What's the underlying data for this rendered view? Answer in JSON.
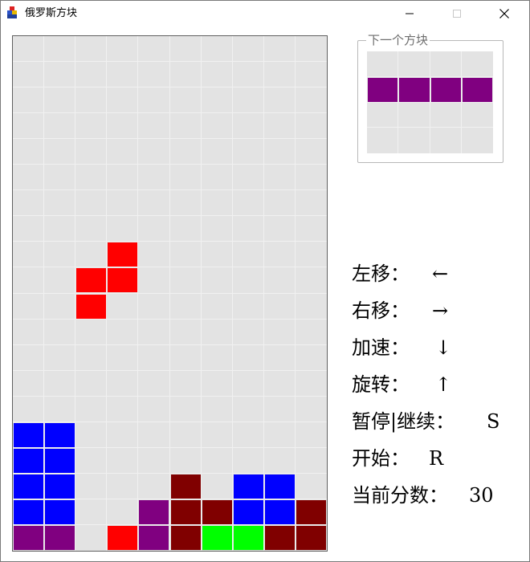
{
  "window": {
    "title": "俄罗斯方块"
  },
  "board": {
    "cols": 10,
    "rows": 20,
    "empty_color": "#e3e3e3",
    "cells": [
      {
        "r": 8,
        "c": 3,
        "color": "#ff0000"
      },
      {
        "r": 9,
        "c": 2,
        "color": "#ff0000"
      },
      {
        "r": 9,
        "c": 3,
        "color": "#ff0000"
      },
      {
        "r": 10,
        "c": 2,
        "color": "#ff0000"
      },
      {
        "r": 15,
        "c": 0,
        "color": "#0000ff"
      },
      {
        "r": 15,
        "c": 1,
        "color": "#0000ff"
      },
      {
        "r": 16,
        "c": 0,
        "color": "#0000ff"
      },
      {
        "r": 16,
        "c": 1,
        "color": "#0000ff"
      },
      {
        "r": 17,
        "c": 0,
        "color": "#0000ff"
      },
      {
        "r": 17,
        "c": 1,
        "color": "#0000ff"
      },
      {
        "r": 17,
        "c": 5,
        "color": "#800000"
      },
      {
        "r": 17,
        "c": 7,
        "color": "#0000ff"
      },
      {
        "r": 17,
        "c": 8,
        "color": "#0000ff"
      },
      {
        "r": 18,
        "c": 0,
        "color": "#0000ff"
      },
      {
        "r": 18,
        "c": 1,
        "color": "#0000ff"
      },
      {
        "r": 18,
        "c": 4,
        "color": "#800080"
      },
      {
        "r": 18,
        "c": 5,
        "color": "#800000"
      },
      {
        "r": 18,
        "c": 6,
        "color": "#800000"
      },
      {
        "r": 18,
        "c": 7,
        "color": "#0000ff"
      },
      {
        "r": 18,
        "c": 8,
        "color": "#0000ff"
      },
      {
        "r": 18,
        "c": 9,
        "color": "#800000"
      },
      {
        "r": 19,
        "c": 0,
        "color": "#800080"
      },
      {
        "r": 19,
        "c": 1,
        "color": "#800080"
      },
      {
        "r": 19,
        "c": 3,
        "color": "#ff0000"
      },
      {
        "r": 19,
        "c": 4,
        "color": "#800080"
      },
      {
        "r": 19,
        "c": 5,
        "color": "#800000"
      },
      {
        "r": 19,
        "c": 6,
        "color": "#00ff00"
      },
      {
        "r": 19,
        "c": 7,
        "color": "#00ff00"
      },
      {
        "r": 19,
        "c": 8,
        "color": "#800000"
      },
      {
        "r": 19,
        "c": 9,
        "color": "#800000"
      }
    ]
  },
  "next_piece": {
    "legend": "下一个方块",
    "cols": 4,
    "rows": 4,
    "cells": [
      {
        "r": 1,
        "c": 0,
        "color": "#800080"
      },
      {
        "r": 1,
        "c": 1,
        "color": "#800080"
      },
      {
        "r": 1,
        "c": 2,
        "color": "#800080"
      },
      {
        "r": 1,
        "c": 3,
        "color": "#800080"
      }
    ]
  },
  "controls": {
    "move_left": {
      "label": "左移：",
      "key": "←"
    },
    "move_right": {
      "label": "右移：",
      "key": "→"
    },
    "speed_up": {
      "label": "加速：",
      "key": "↓"
    },
    "rotate": {
      "label": "旋转：",
      "key": "↑"
    },
    "pause": {
      "label": "暂停|继续：",
      "key": "S"
    },
    "start": {
      "label": "开始：",
      "key": "R"
    },
    "score": {
      "label": "当前分数：",
      "value": "30"
    }
  }
}
